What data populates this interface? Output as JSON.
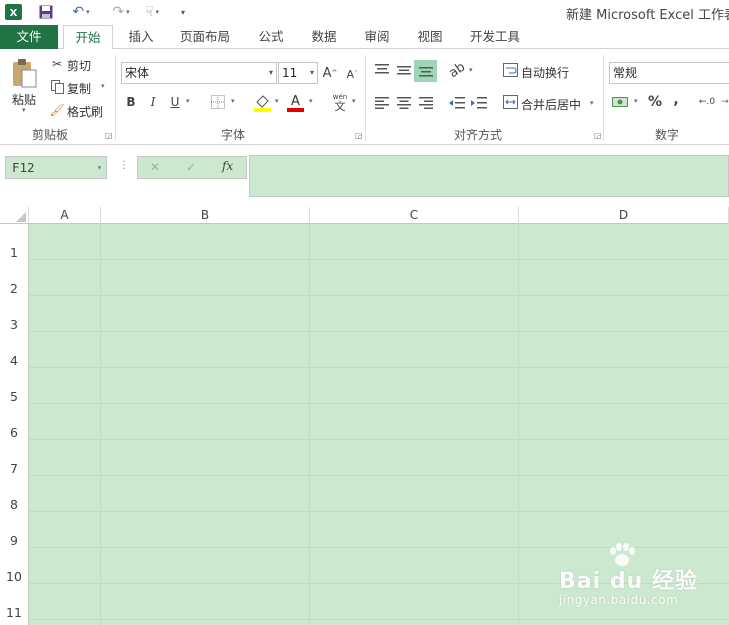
{
  "window": {
    "title": "新建 Microsoft Excel 工作表.x"
  },
  "tabs": [
    {
      "label": "文件"
    },
    {
      "label": "开始"
    },
    {
      "label": "插入"
    },
    {
      "label": "页面布局"
    },
    {
      "label": "公式"
    },
    {
      "label": "数据"
    },
    {
      "label": "审阅"
    },
    {
      "label": "视图"
    },
    {
      "label": "开发工具"
    }
  ],
  "clipboard": {
    "paste": "粘贴",
    "cut": "剪切",
    "copy": "复制",
    "format_painter": "格式刷",
    "group": "剪贴板"
  },
  "font": {
    "name": "宋体",
    "size": "11",
    "bold": "B",
    "italic": "I",
    "underline": "U",
    "group": "字体",
    "phonetic": "wén"
  },
  "alignment": {
    "wrap": "自动换行",
    "merge": "合并后居中",
    "group": "对齐方式"
  },
  "number": {
    "format": "常规",
    "percent": "%",
    "comma": ",",
    "group": "数字"
  },
  "formula_bar": {
    "name_box": "F12",
    "fx": "fx",
    "cancel": "✕",
    "enter": "✓"
  },
  "columns": [
    "A",
    "B",
    "C",
    "D"
  ],
  "rows": [
    "1",
    "2",
    "3",
    "4",
    "5",
    "6",
    "7",
    "8",
    "9",
    "10",
    "11"
  ],
  "watermark": {
    "brand": "Bai du 经验",
    "url": "jingyan.baidu.com"
  },
  "colors": {
    "accent": "#217346",
    "cell_bg": "#cce8cf"
  }
}
